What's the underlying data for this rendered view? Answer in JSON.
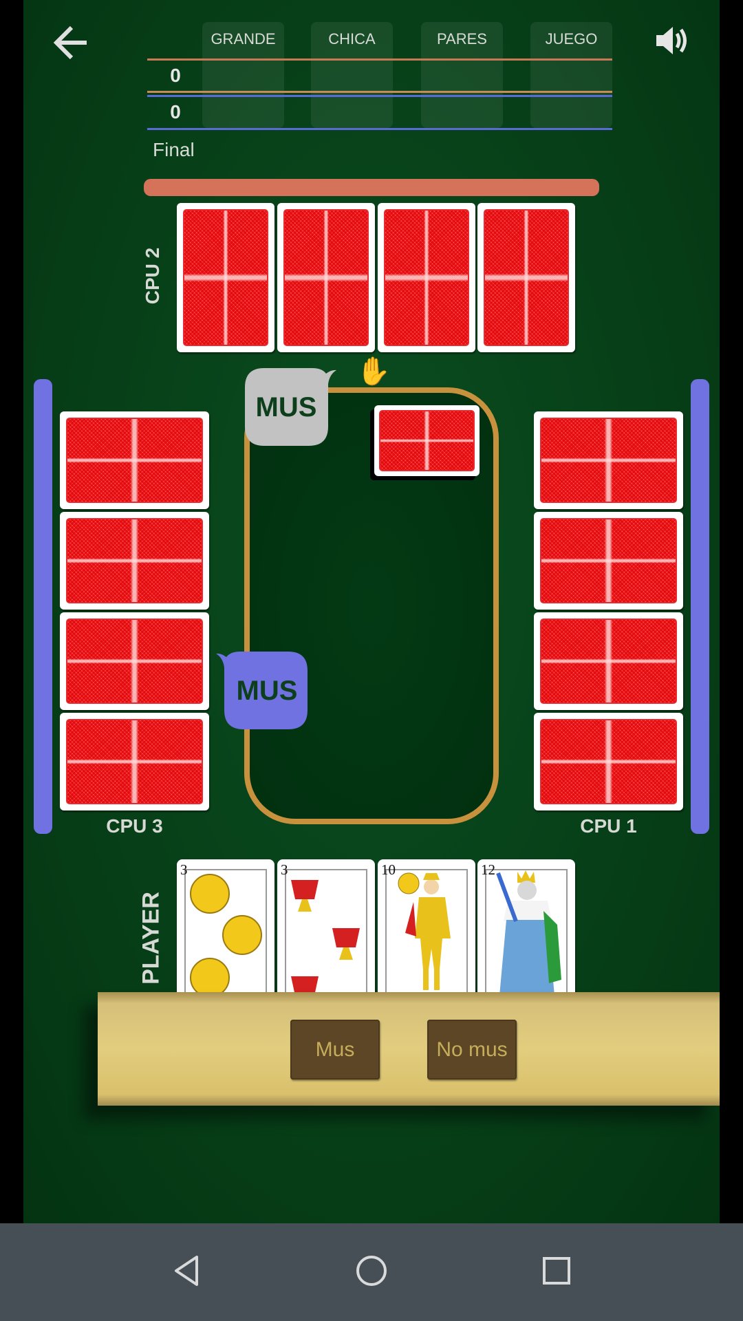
{
  "scoreboard": {
    "columns": [
      "GRANDE",
      "CHICA",
      "PARES",
      "JUEGO"
    ],
    "team1_score": "0",
    "team2_score": "0",
    "status": "Final",
    "team1_color": "#d4735a",
    "team2_color": "#6f72e0"
  },
  "players": {
    "top": "CPU 2",
    "left": "CPU 3",
    "right": "CPU 1",
    "bottom": "PLAYER"
  },
  "bubbles": {
    "cpu2": "MUS",
    "cpu3": "MUS"
  },
  "hand": [
    {
      "rank": "3",
      "suit": "oros"
    },
    {
      "rank": "3",
      "suit": "copas"
    },
    {
      "rank": "10",
      "suit": "oros"
    },
    {
      "rank": "12",
      "suit": "espadas"
    }
  ],
  "actions": {
    "mus": "Mus",
    "no_mus": "No mus"
  },
  "icons": {
    "back": "arrow-left-icon",
    "sound": "speaker-icon",
    "turn": "raised-hand-icon"
  }
}
